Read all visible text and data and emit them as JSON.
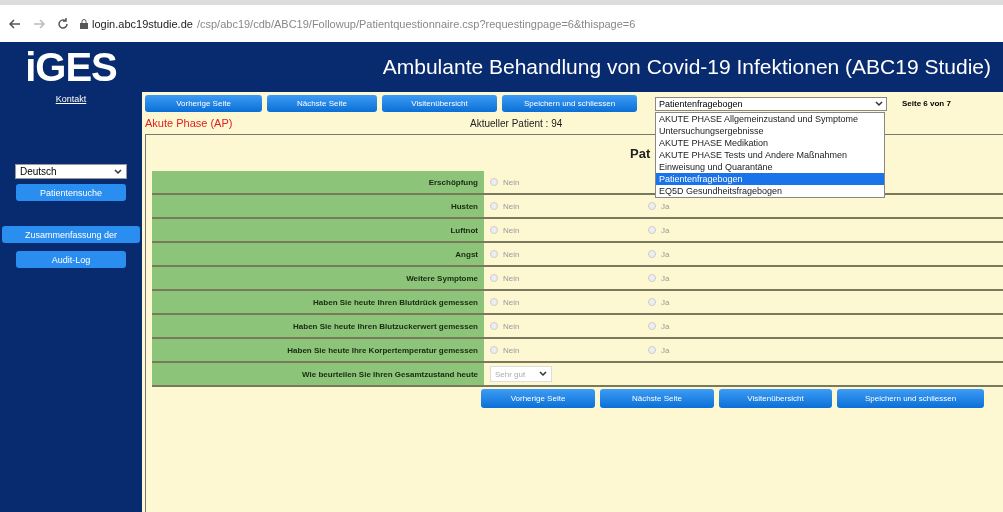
{
  "browser": {
    "url_host": "login.abc19studie.de",
    "url_path": "/csp/abc19/cdb/ABC19/Followup/Patientquestionnaire.csp?requestingpage=6&thispage=6"
  },
  "header": {
    "logo": "iGES",
    "title": "Ambulante Behandlung von Covid-19 Infektionen (ABC19 Studie)"
  },
  "sidebar": {
    "contact_link": "Kontakt",
    "language": "Deutsch",
    "buttons": [
      "Patientensuche",
      "Zusammenfassung der",
      "Audit-Log"
    ]
  },
  "nav_buttons": [
    "Vorherige Seite",
    "Nächste Seite",
    "Visitenübersicht",
    "Speichern und schliessen"
  ],
  "page_select": {
    "value": "Patientenfragebogen",
    "options": [
      {
        "label": "AKUTE PHASE Allgemeinzustand und Symptome",
        "selected": false
      },
      {
        "label": "Untersuchungsergebnisse",
        "selected": false
      },
      {
        "label": "AKUTE PHASE Medikation",
        "selected": false
      },
      {
        "label": "AKUTE PHASE Tests und Andere Maßnahmen",
        "selected": false
      },
      {
        "label": "Einweisung und Quarantäne",
        "selected": false
      },
      {
        "label": "Patientenfragebogen",
        "selected": true
      },
      {
        "label": "EQ5D Gesundheitsfragebogen",
        "selected": false
      }
    ]
  },
  "page_indicator": "Seite 6 von 7",
  "phase": "Akute Phase (AP)",
  "current_patient": "Aktueller Patient : 94",
  "form": {
    "title": "Pat",
    "rows": [
      {
        "label": "Erschöpfung",
        "kind": "radio",
        "options": [
          {
            "label": "Nein",
            "selected": false
          }
        ]
      },
      {
        "label": "Husten",
        "kind": "radio",
        "options": [
          {
            "label": "Nein",
            "selected": false
          },
          {
            "label": "Ja",
            "selected": false
          }
        ]
      },
      {
        "label": "Luftnot",
        "kind": "radio",
        "options": [
          {
            "label": "Nein",
            "selected": false
          },
          {
            "label": "Ja",
            "selected": false
          }
        ]
      },
      {
        "label": "Angst",
        "kind": "radio",
        "options": [
          {
            "label": "Nein",
            "selected": false
          },
          {
            "label": "Ja",
            "selected": false
          }
        ]
      },
      {
        "label": "Weitere Symptome",
        "kind": "radio",
        "options": [
          {
            "label": "Nein",
            "selected": false
          },
          {
            "label": "Ja",
            "selected": false
          }
        ]
      },
      {
        "label": "Haben Sie heute Ihren Blutdrück gemessen",
        "kind": "radio",
        "options": [
          {
            "label": "Nein",
            "selected": false
          },
          {
            "label": "Ja",
            "selected": false
          }
        ]
      },
      {
        "label": "Haben Sie heute Ihren Blutzuckerwert gemessen",
        "kind": "radio",
        "options": [
          {
            "label": "Nein",
            "selected": false
          },
          {
            "label": "Ja",
            "selected": false
          }
        ]
      },
      {
        "label": "Haben Sie heute Ihre Korpertemperatur gemessen",
        "kind": "radio",
        "options": [
          {
            "label": "Nein",
            "selected": false
          },
          {
            "label": "Ja",
            "selected": false
          }
        ]
      },
      {
        "label": "Wie beurteilen Sie Ihren Gesamtzustand heute",
        "kind": "select",
        "value": "Sehr gut"
      }
    ]
  },
  "bottom_buttons": [
    "Vorherige Seite",
    "Nächste Seite",
    "Visitenübersicht",
    "Speichern und schliessen"
  ]
}
